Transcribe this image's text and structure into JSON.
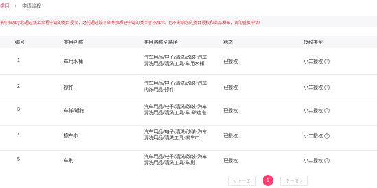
{
  "breadcrumb": {
    "parent": "类目",
    "current": "申请流程"
  },
  "notice": "表中仅展示您通过线上流程申请的类目授权，之前通过线下邮寄资质已申请的类目暂不展示。也不影响您的类目授权和商品发布，请勿重复申请!",
  "table": {
    "columns": [
      "编号",
      "类目名称",
      "类目名称全路径",
      "状态",
      "授权类型"
    ],
    "rows": [
      {
        "no": "1",
        "name": "车用水桶",
        "path1": "汽车用品/电子/清洗/改装-汽车",
        "path2": "清洗用品/清洗工具-车用水桶",
        "status": "已授权",
        "auth": "小二授权"
      },
      {
        "no": "2",
        "name": "擦件",
        "path1": "汽车用品/电子/清洗/改装-汽车",
        "path2": "内饰用品-擦件",
        "status": "已授权",
        "auth": "小二授权"
      },
      {
        "no": "3",
        "name": "车掸/蜡拖",
        "path1": "汽车用品/电子/清洗/改装-汽车",
        "path2": "清洗用品/清洗工具-车掸/蜡拖",
        "status": "已授权",
        "auth": "小二授权"
      },
      {
        "no": "4",
        "name": "擦车巾",
        "path1": "汽车用品/电子/清洗/改装-汽车",
        "path2": "清洗用品/清洗工具-擦车巾",
        "status": "已授权",
        "auth": "小二授权"
      },
      {
        "no": "5",
        "name": "车刷",
        "path1": "汽车用品/电子/清洗/改装-汽车",
        "path2": "清洗用品/清洗工具-车刷",
        "status": "已授权",
        "auth": "小二授权"
      }
    ]
  },
  "pagination": {
    "prev": "< 上一页",
    "current": "1",
    "next": "下一页 >"
  },
  "colors": {
    "accent": "#ff3d6e",
    "notice_text": "#d63a3a",
    "header_bg": "#f7f7f9"
  }
}
